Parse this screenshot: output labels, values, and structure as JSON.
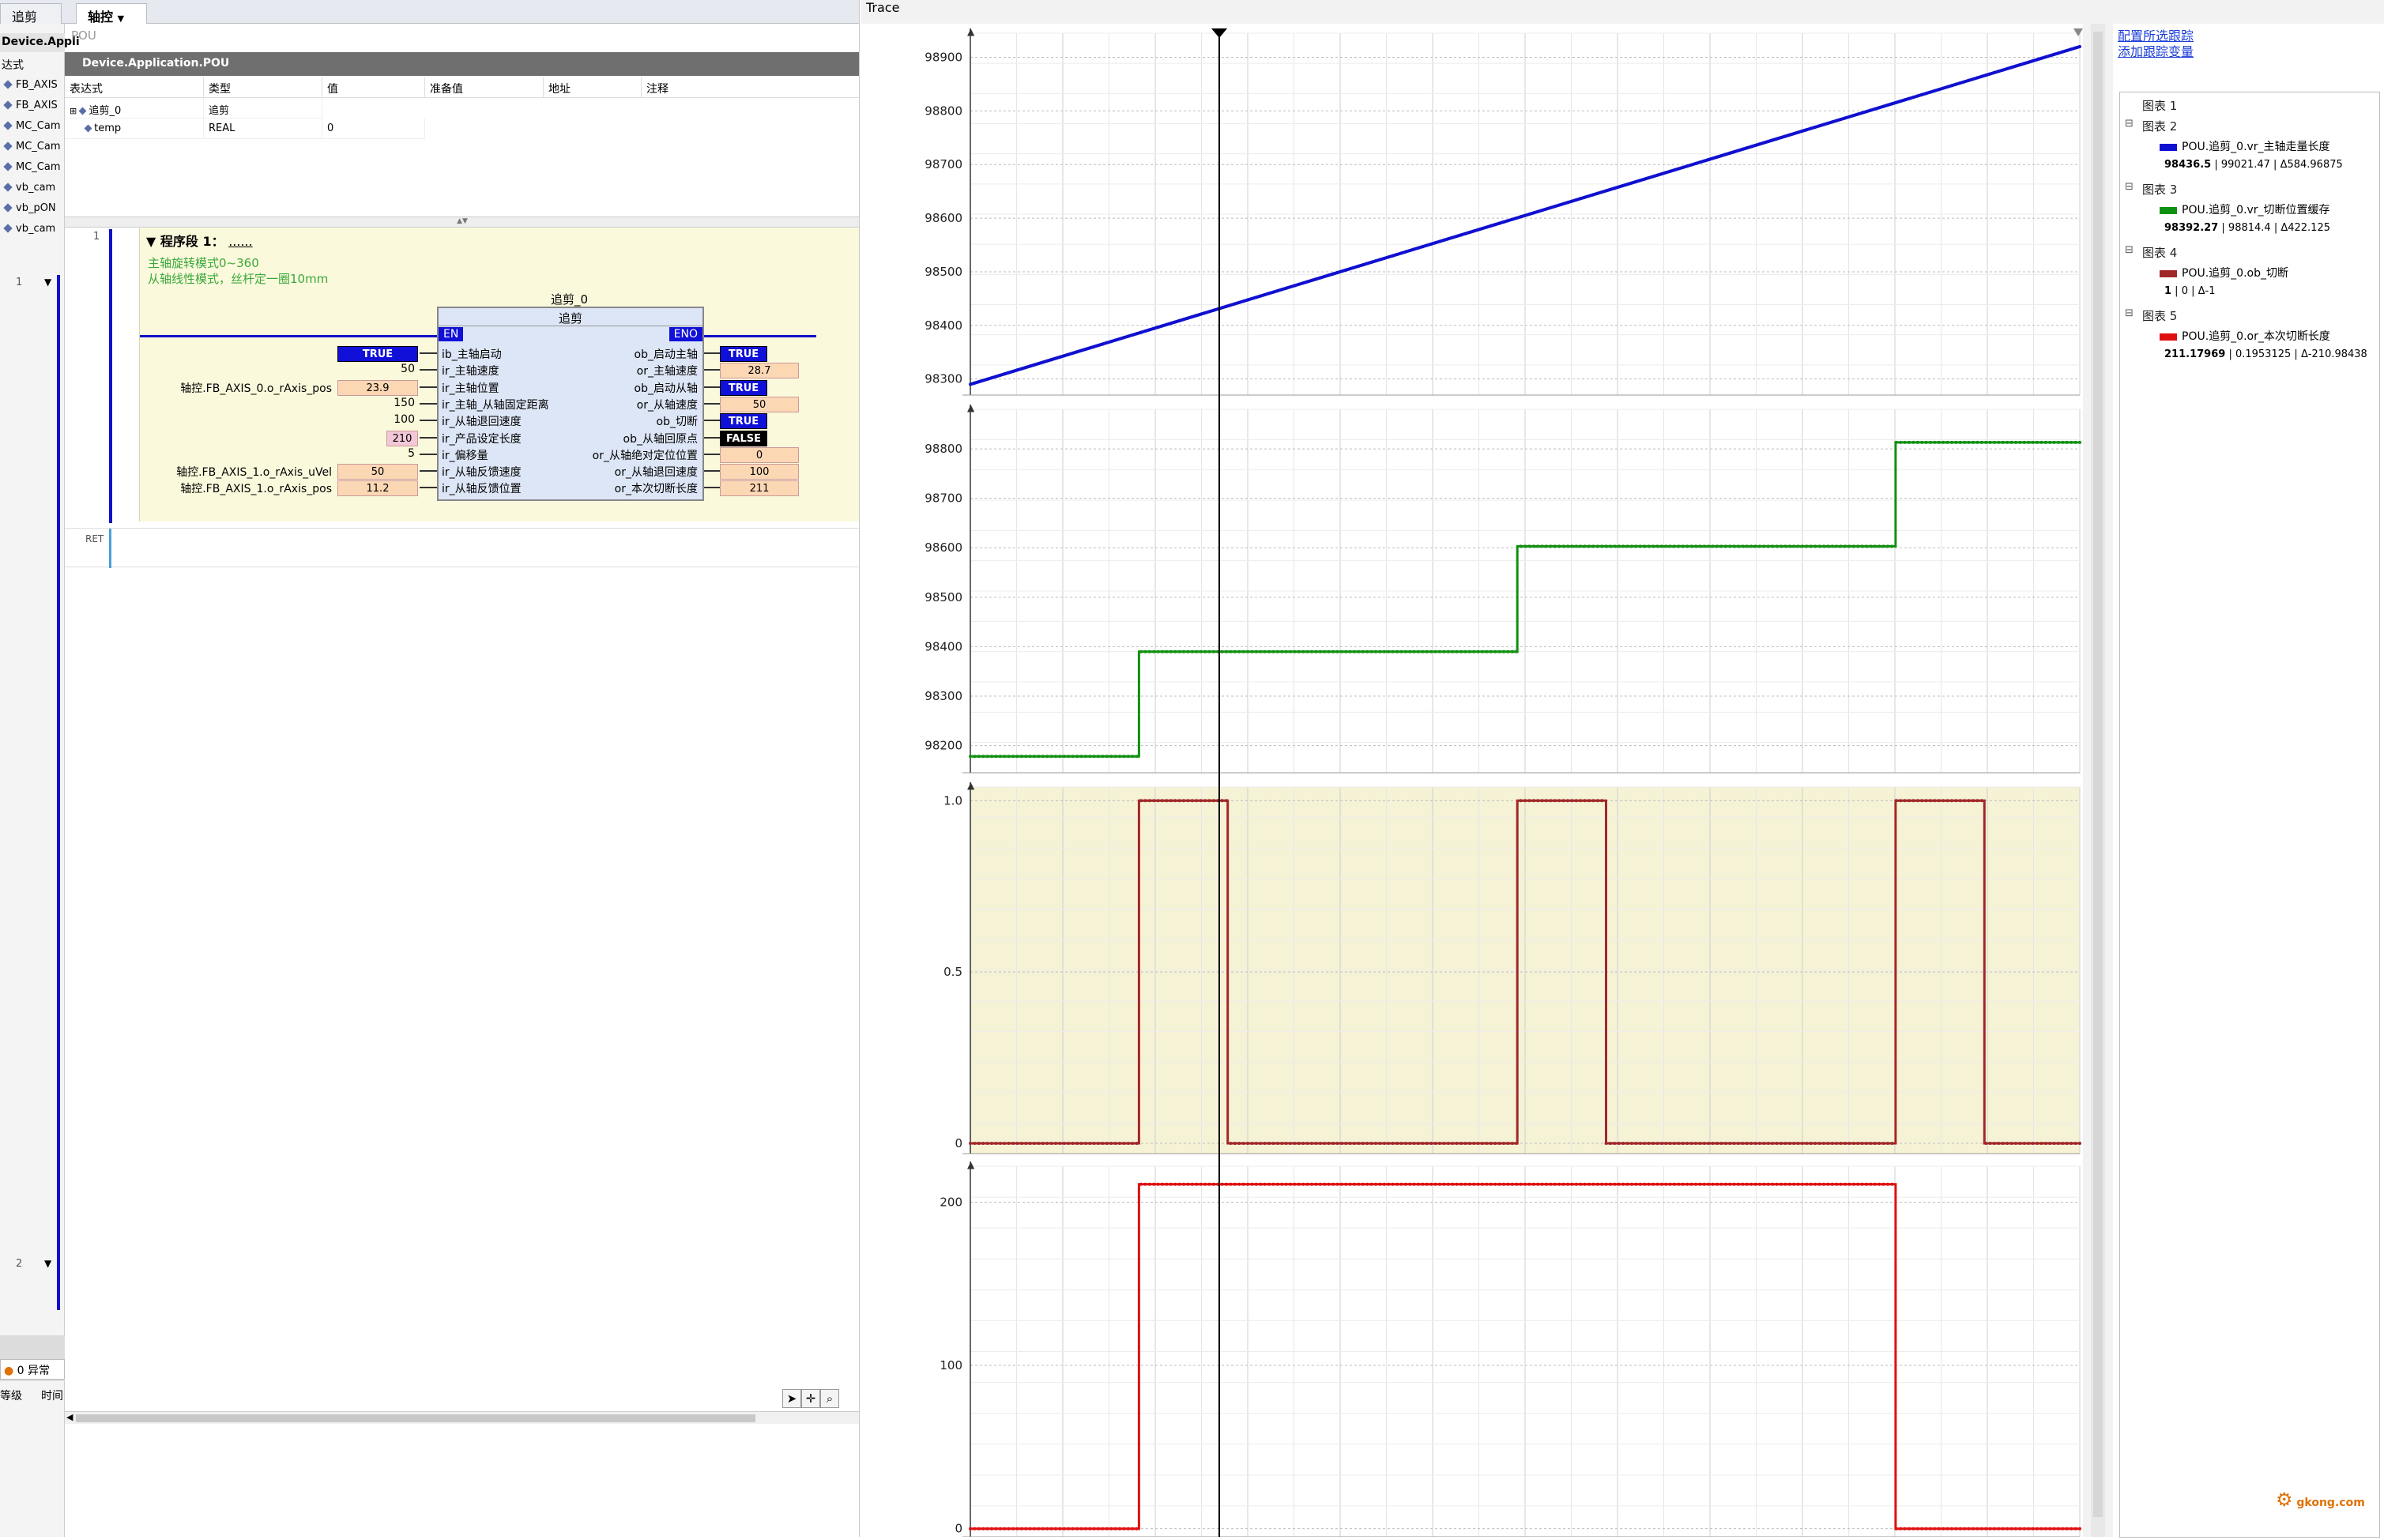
{
  "tabs": [
    {
      "label": "追剪"
    },
    {
      "label": "轴控"
    }
  ],
  "left_vars": [
    "FB_AXIS",
    "FB_AXIS",
    "MC_Cam",
    "MC_Cam",
    "MC_Cam",
    "vb_cam",
    "vb_pON",
    "vb_cam"
  ],
  "left_headers": {
    "device": "Device.Appli",
    "expr": "达式"
  },
  "pou_title": "POU",
  "device_path": "Device.Application.POU",
  "var_table": {
    "headers": [
      "表达式",
      "类型",
      "值",
      "准备值",
      "地址",
      "注释"
    ],
    "rows": [
      {
        "expr": "追剪_0",
        "type": "追剪",
        "value": ""
      },
      {
        "expr": "temp",
        "type": "REAL",
        "value": "0"
      }
    ]
  },
  "network": {
    "number": "1",
    "segment_label": "程序段 1：",
    "segment_dots": "......",
    "comment1": "主轴旋转模式0~360",
    "comment2": "从轴线性模式，丝杆定一圈10mm",
    "instance": "追剪_0",
    "type": "追剪",
    "en": "EN",
    "eno": "ENO",
    "inputs": [
      {
        "pin": "ib_主轴启动",
        "val": "TRUE",
        "kind": "blue",
        "label": ""
      },
      {
        "pin": "ir_主轴速度",
        "val": "50",
        "kind": "text",
        "label": ""
      },
      {
        "pin": "ir_主轴位置",
        "val": "23.9",
        "kind": "orange",
        "label": "轴控.FB_AXIS_0.o_rAxis_pos"
      },
      {
        "pin": "ir_主轴_从轴固定距离",
        "val": "150",
        "kind": "text",
        "label": ""
      },
      {
        "pin": "ir_从轴退回速度",
        "val": "100",
        "kind": "text",
        "label": ""
      },
      {
        "pin": "ir_产品设定长度",
        "val": "210",
        "kind": "pink",
        "label": ""
      },
      {
        "pin": "ir_偏移量",
        "val": "5",
        "kind": "text",
        "label": ""
      },
      {
        "pin": "ir_从轴反馈速度",
        "val": "50",
        "kind": "orange",
        "label": "轴控.FB_AXIS_1.o_rAxis_uVel"
      },
      {
        "pin": "ir_从轴反馈位置",
        "val": "11.2",
        "kind": "orange",
        "label": "轴控.FB_AXIS_1.o_rAxis_pos"
      }
    ],
    "outputs": [
      {
        "pin": "ob_启动主轴",
        "val": "TRUE",
        "kind": "blue"
      },
      {
        "pin": "or_主轴速度",
        "val": "28.7",
        "kind": "orange"
      },
      {
        "pin": "ob_启动从轴",
        "val": "TRUE",
        "kind": "blue"
      },
      {
        "pin": "or_从轴速度",
        "val": "50",
        "kind": "orange"
      },
      {
        "pin": "ob_切断",
        "val": "TRUE",
        "kind": "blue"
      },
      {
        "pin": "ob_从轴回原点",
        "val": "FALSE",
        "kind": "black"
      },
      {
        "pin": "or_从轴绝对定位位置",
        "val": "0",
        "kind": "orange"
      },
      {
        "pin": "or_从轴退回速度",
        "val": "100",
        "kind": "orange"
      },
      {
        "pin": "or_本次切断长度",
        "val": "211",
        "kind": "orange"
      }
    ],
    "ret": "RET",
    "second_network": "2"
  },
  "status": {
    "errors": "0 异常",
    "col1": "等级",
    "col2": "时间"
  },
  "trace": {
    "title": "Trace",
    "links": [
      "配置所选跟踪",
      "添加跟踪变量"
    ],
    "legend": [
      {
        "chart": "图表 1",
        "var": "",
        "v1": "",
        "v2": "",
        "delta": "",
        "color": ""
      },
      {
        "chart": "图表 2",
        "var": "POU.追剪_0.vr_主轴走量长度",
        "v1": "98436.5",
        "v2": "99021.47",
        "delta": "Δ584.96875",
        "color": "#1010d0"
      },
      {
        "chart": "图表 3",
        "var": "POU.追剪_0.vr_切断位置缓存",
        "v1": "98392.27",
        "v2": "98814.4",
        "delta": "Δ422.125",
        "color": "#109010"
      },
      {
        "chart": "图表 4",
        "var": "POU.追剪_0.ob_切断",
        "v1": "1",
        "v2": "0",
        "delta": "Δ-1",
        "color": "#a02828"
      },
      {
        "chart": "图表 5",
        "var": "POU.追剪_0.or_本次切断长度",
        "v1": "211.17969",
        "v2": "0.1953125",
        "delta": "Δ-210.98438",
        "color": "#e01010"
      }
    ],
    "watermark": "gkong.com"
  },
  "chart_data": [
    {
      "type": "line",
      "title": "",
      "series": [
        {
          "name": "POU.追剪_0.vr_主轴走量长度",
          "x": [
            0,
            1
          ],
          "values": [
            98290,
            98920
          ]
        }
      ],
      "yticks": [
        98300,
        98400,
        98500,
        98600,
        98700,
        98800,
        98900
      ],
      "ylim": [
        98270,
        98945
      ],
      "color": "#1010d0"
    },
    {
      "type": "line",
      "title": "",
      "series": [
        {
          "name": "POU.追剪_0.vr_切断位置缓存",
          "x": [
            0,
            0.152,
            0.152,
            0.493,
            0.493,
            0.834,
            0.834,
            1
          ],
          "values": [
            98178,
            98178,
            98390,
            98390,
            98603,
            98603,
            98813,
            98813
          ]
        }
      ],
      "yticks": [
        98200,
        98300,
        98400,
        98500,
        98600,
        98700,
        98800
      ],
      "ylim": [
        98145,
        98880
      ],
      "color": "#109010"
    },
    {
      "type": "line",
      "title": "",
      "series": [
        {
          "name": "POU.追剪_0.ob_切断",
          "x": [
            0,
            0.152,
            0.152,
            0.232,
            0.232,
            0.493,
            0.493,
            0.573,
            0.573,
            0.834,
            0.834,
            0.914,
            0.914,
            1
          ],
          "values": [
            0,
            0,
            1,
            1,
            0,
            0,
            1,
            1,
            0,
            0,
            1,
            1,
            0,
            0
          ]
        }
      ],
      "yticks": [
        0,
        0.5,
        1.0
      ],
      "yticklabels": [
        "0",
        "0.5",
        "1.0"
      ],
      "ylim": [
        -0.03,
        1.04
      ],
      "color": "#a02828"
    },
    {
      "type": "line",
      "title": "",
      "series": [
        {
          "name": "POU.追剪_0.or_本次切断长度",
          "x": [
            0,
            0.152,
            0.152,
            0.834,
            0.834,
            1
          ],
          "values": [
            0,
            0,
            211,
            211,
            0,
            0
          ]
        }
      ],
      "yticks": [
        0,
        100,
        200
      ],
      "ylim": [
        -5,
        222
      ],
      "color": "#e01010"
    }
  ]
}
